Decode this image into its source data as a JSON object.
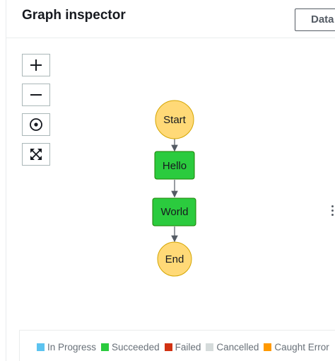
{
  "header": {
    "title": "Graph inspector",
    "data_tab_label": "Data"
  },
  "controls": {
    "zoom_in_icon": "plus-icon",
    "zoom_out_icon": "minus-icon",
    "center_icon": "target-icon",
    "fit_icon": "expand-arrows-icon"
  },
  "graph": {
    "nodes": [
      {
        "id": "start",
        "label": "Start",
        "shape": "circle",
        "color": "#ffd977"
      },
      {
        "id": "hello",
        "label": "Hello",
        "shape": "rect",
        "color": "#2bcb3e"
      },
      {
        "id": "world",
        "label": "World",
        "shape": "rect",
        "color": "#2bcb3e"
      },
      {
        "id": "end",
        "label": "End",
        "shape": "circle",
        "color": "#ffd977"
      }
    ],
    "edges": [
      {
        "from": "start",
        "to": "hello"
      },
      {
        "from": "hello",
        "to": "world"
      },
      {
        "from": "world",
        "to": "end"
      }
    ]
  },
  "legend": {
    "items": [
      {
        "label": "In Progress",
        "color": "#5cc3f0"
      },
      {
        "label": "Succeeded",
        "color": "#2bcb3e"
      },
      {
        "label": "Failed",
        "color": "#d13212"
      },
      {
        "label": "Cancelled",
        "color": "#d5dbdb"
      },
      {
        "label": "Caught Error",
        "color": "#ff9900"
      }
    ]
  },
  "colors": {
    "node_stroke": "#d4a500",
    "task_stroke": "#1d8102",
    "edge": "#545b64"
  }
}
